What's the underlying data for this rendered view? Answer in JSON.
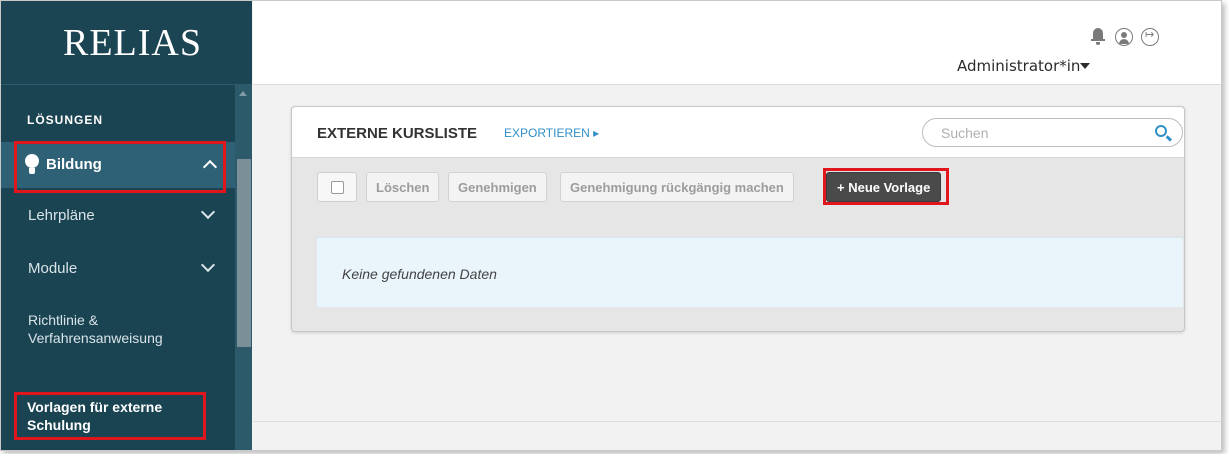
{
  "app": {
    "logo": "RELIAS"
  },
  "sidebar": {
    "heading": "LÖSUNGEN",
    "items": [
      {
        "label": "Bildung",
        "expanded": true,
        "icon": "lightbulb-icon"
      },
      {
        "label": "Lehrpläne",
        "expanded": false
      },
      {
        "label": "Module",
        "expanded": false
      },
      {
        "label": "Richtlinie & Verfahrensanweisung"
      },
      {
        "label": "Vorlagen für externe Schulung",
        "selected": true
      }
    ]
  },
  "header": {
    "user_label": "Administrator*in",
    "icons": [
      "bell-icon",
      "user-circle-icon",
      "logout-icon"
    ]
  },
  "card": {
    "title": "EXTERNE KURSLISTE",
    "export_label": "EXPORTIEREN ▸",
    "search_placeholder": "Suchen",
    "toolbar": {
      "delete_label": "Löschen",
      "approve_label": "Genehmigen",
      "revoke_label": "Genehmigung rückgängig machen",
      "new_template_label": "+ Neue Vorlage"
    },
    "empty_message": "Keine gefundenen Daten"
  },
  "colors": {
    "sidebar_bg": "#1b4453",
    "active_item_bg": "#2e6176",
    "highlight_border": "#e1161c",
    "accent_blue": "#2f8fc7",
    "primary_button": "#4a4a4a"
  }
}
